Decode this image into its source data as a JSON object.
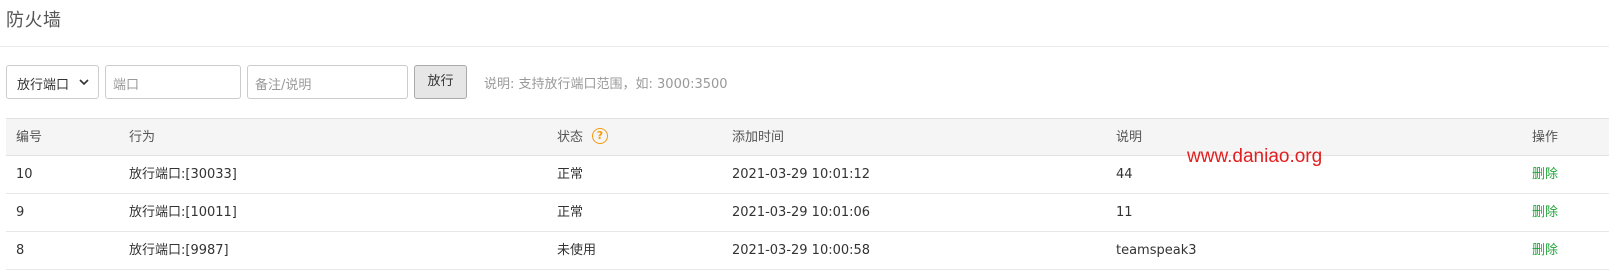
{
  "header": {
    "title": "防火墙"
  },
  "toolbar": {
    "select_value": "放行端口",
    "port_placeholder": "端口",
    "note_placeholder": "备注/说明",
    "allow_button": "放行",
    "hint": "说明: 支持放行端口范围，如: 3000:3500"
  },
  "table": {
    "columns": [
      "编号",
      "行为",
      "状态",
      "添加时间",
      "说明",
      "操作"
    ],
    "status_help_icon": "question-circle-icon",
    "rows": [
      {
        "id": "10",
        "action": "放行端口:[30033]",
        "status": "正常",
        "time": "2021-03-29 10:01:12",
        "note": "44",
        "op": "删除"
      },
      {
        "id": "9",
        "action": "放行端口:[10011]",
        "status": "正常",
        "time": "2021-03-29 10:01:06",
        "note": "11",
        "op": "删除"
      },
      {
        "id": "8",
        "action": "放行端口:[9987]",
        "status": "未使用",
        "time": "2021-03-29 10:00:58",
        "note": "teamspeak3",
        "op": "删除"
      }
    ]
  },
  "watermark": "www.daniao.org",
  "colors": {
    "link_green": "#20a53a",
    "help_orange": "#f39c12",
    "watermark_red": "#e02020"
  }
}
